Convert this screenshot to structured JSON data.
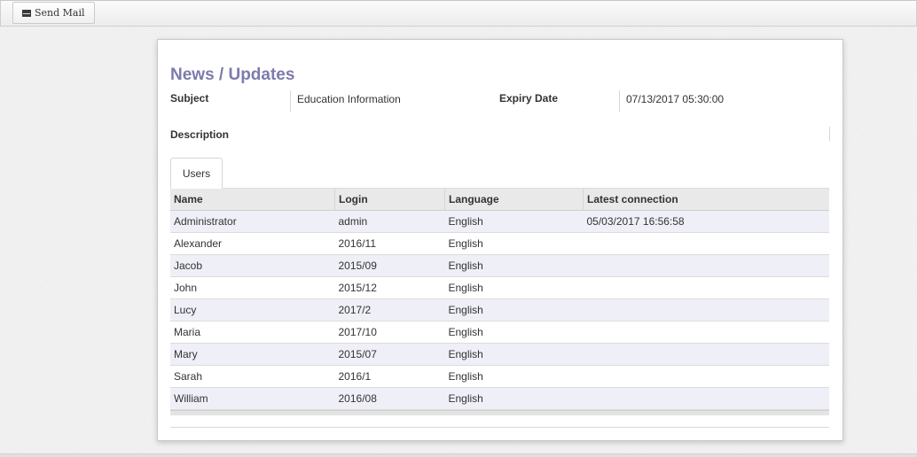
{
  "toolbar": {
    "send_mail_label": "Send Mail",
    "send_mail_icon": "envelope-icon"
  },
  "form": {
    "title": "News / Updates",
    "subject_label": "Subject",
    "subject_value": "Education Information",
    "expiry_label": "Expiry Date",
    "expiry_value": "07/13/2017 05:30:00",
    "description_label": "Description",
    "description_value": ""
  },
  "tabs": [
    {
      "label": "Users"
    }
  ],
  "users_table": {
    "columns": [
      "Name",
      "Login",
      "Language",
      "Latest connection"
    ],
    "rows": [
      [
        "Administrator",
        "admin",
        "English",
        "05/03/2017 16:56:58"
      ],
      [
        "Alexander",
        "2016/11",
        "English",
        ""
      ],
      [
        "Jacob",
        "2015/09",
        "English",
        ""
      ],
      [
        "John",
        "2015/12",
        "English",
        ""
      ],
      [
        "Lucy",
        "2017/2",
        "English",
        ""
      ],
      [
        "Maria",
        "2017/10",
        "English",
        ""
      ],
      [
        "Mary",
        "2015/07",
        "English",
        ""
      ],
      [
        "Sarah",
        "2016/1",
        "English",
        ""
      ],
      [
        "William",
        "2016/08",
        "English",
        ""
      ]
    ]
  },
  "colors": {
    "title": "#7c7bad",
    "row_alt": "#efeff8",
    "header_bg": "#e9e9e9"
  }
}
